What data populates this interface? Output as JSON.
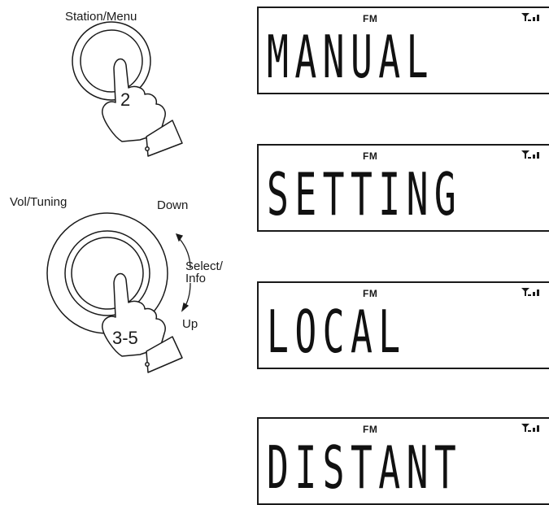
{
  "controls": {
    "station_button": {
      "label": "Station/Menu",
      "step": "2"
    },
    "vol_tuning_knob": {
      "label": "Vol/Tuning",
      "direction_down": "Down",
      "direction_select": "Select/\nInfo",
      "direction_up": "Up",
      "step": "3-5"
    }
  },
  "displays": [
    {
      "band": "FM",
      "text": "MANUAL",
      "icon": "signal-strength-icon"
    },
    {
      "band": "FM",
      "text": "SETTING",
      "icon": "signal-strength-icon"
    },
    {
      "band": "FM",
      "text": "LOCAL",
      "icon": "signal-strength-icon"
    },
    {
      "band": "FM",
      "text": "DISTANT",
      "icon": "signal-strength-icon"
    }
  ],
  "colors": {
    "ink": "#1a1a1a",
    "background": "#ffffff"
  }
}
